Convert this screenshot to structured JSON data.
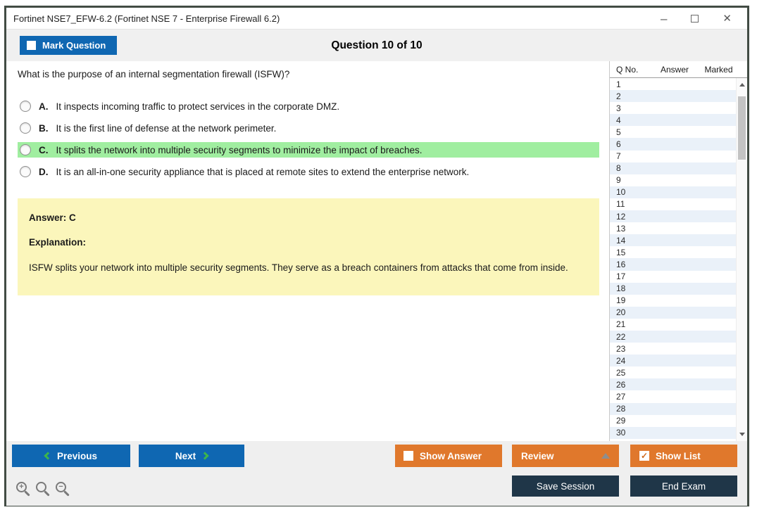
{
  "window": {
    "title": "Fortinet NSE7_EFW-6.2 (Fortinet NSE 7 - Enterprise Firewall 6.2)"
  },
  "header": {
    "mark_question_label": "Mark Question",
    "question_counter": "Question 10 of 10"
  },
  "question": {
    "text": "What is the purpose of an internal segmentation firewall (ISFW)?",
    "options": [
      {
        "letter": "A.",
        "text": "It inspects incoming traffic to protect services in the corporate DMZ.",
        "highlighted": false
      },
      {
        "letter": "B.",
        "text": "It is the first line of defense at the network perimeter.",
        "highlighted": false
      },
      {
        "letter": "C.",
        "text": "It splits the network into multiple security segments to minimize the impact of breaches.",
        "highlighted": true
      },
      {
        "letter": "D.",
        "text": "It is an all-in-one security appliance that is placed at remote sites to extend the enterprise network.",
        "highlighted": false
      }
    ]
  },
  "answer_panel": {
    "answer_label": "Answer: C",
    "explanation_label": "Explanation:",
    "explanation_text": "ISFW splits your network into multiple security segments. They serve as a breach containers from attacks that come from inside."
  },
  "question_list": {
    "columns": [
      "Q No.",
      "Answer",
      "Marked"
    ],
    "rows": [
      1,
      2,
      3,
      4,
      5,
      6,
      7,
      8,
      9,
      10,
      11,
      12,
      13,
      14,
      15,
      16,
      17,
      18,
      19,
      20,
      21,
      22,
      23,
      24,
      25,
      26,
      27,
      28,
      29,
      30
    ]
  },
  "footer": {
    "previous_label": "Previous",
    "next_label": "Next",
    "show_answer_label": "Show Answer",
    "show_answer_checked": false,
    "review_label": "Review",
    "show_list_label": "Show List",
    "show_list_checked": true,
    "save_session_label": "Save Session",
    "end_exam_label": "End Exam"
  },
  "icons": {
    "minimize": "–",
    "close": "✕",
    "check": "✓",
    "zoom_in_sign": "+",
    "zoom_out_sign": "−"
  },
  "colors": {
    "accent_blue": "#0f67b2",
    "accent_orange": "#e0782c",
    "dark_navy": "#1f3648",
    "highlight_green": "#a0eea0",
    "answer_panel_yellow": "#fbf6bb",
    "row_alternate_blue": "#eaf1f9",
    "chevron_green": "#3cb54b"
  }
}
